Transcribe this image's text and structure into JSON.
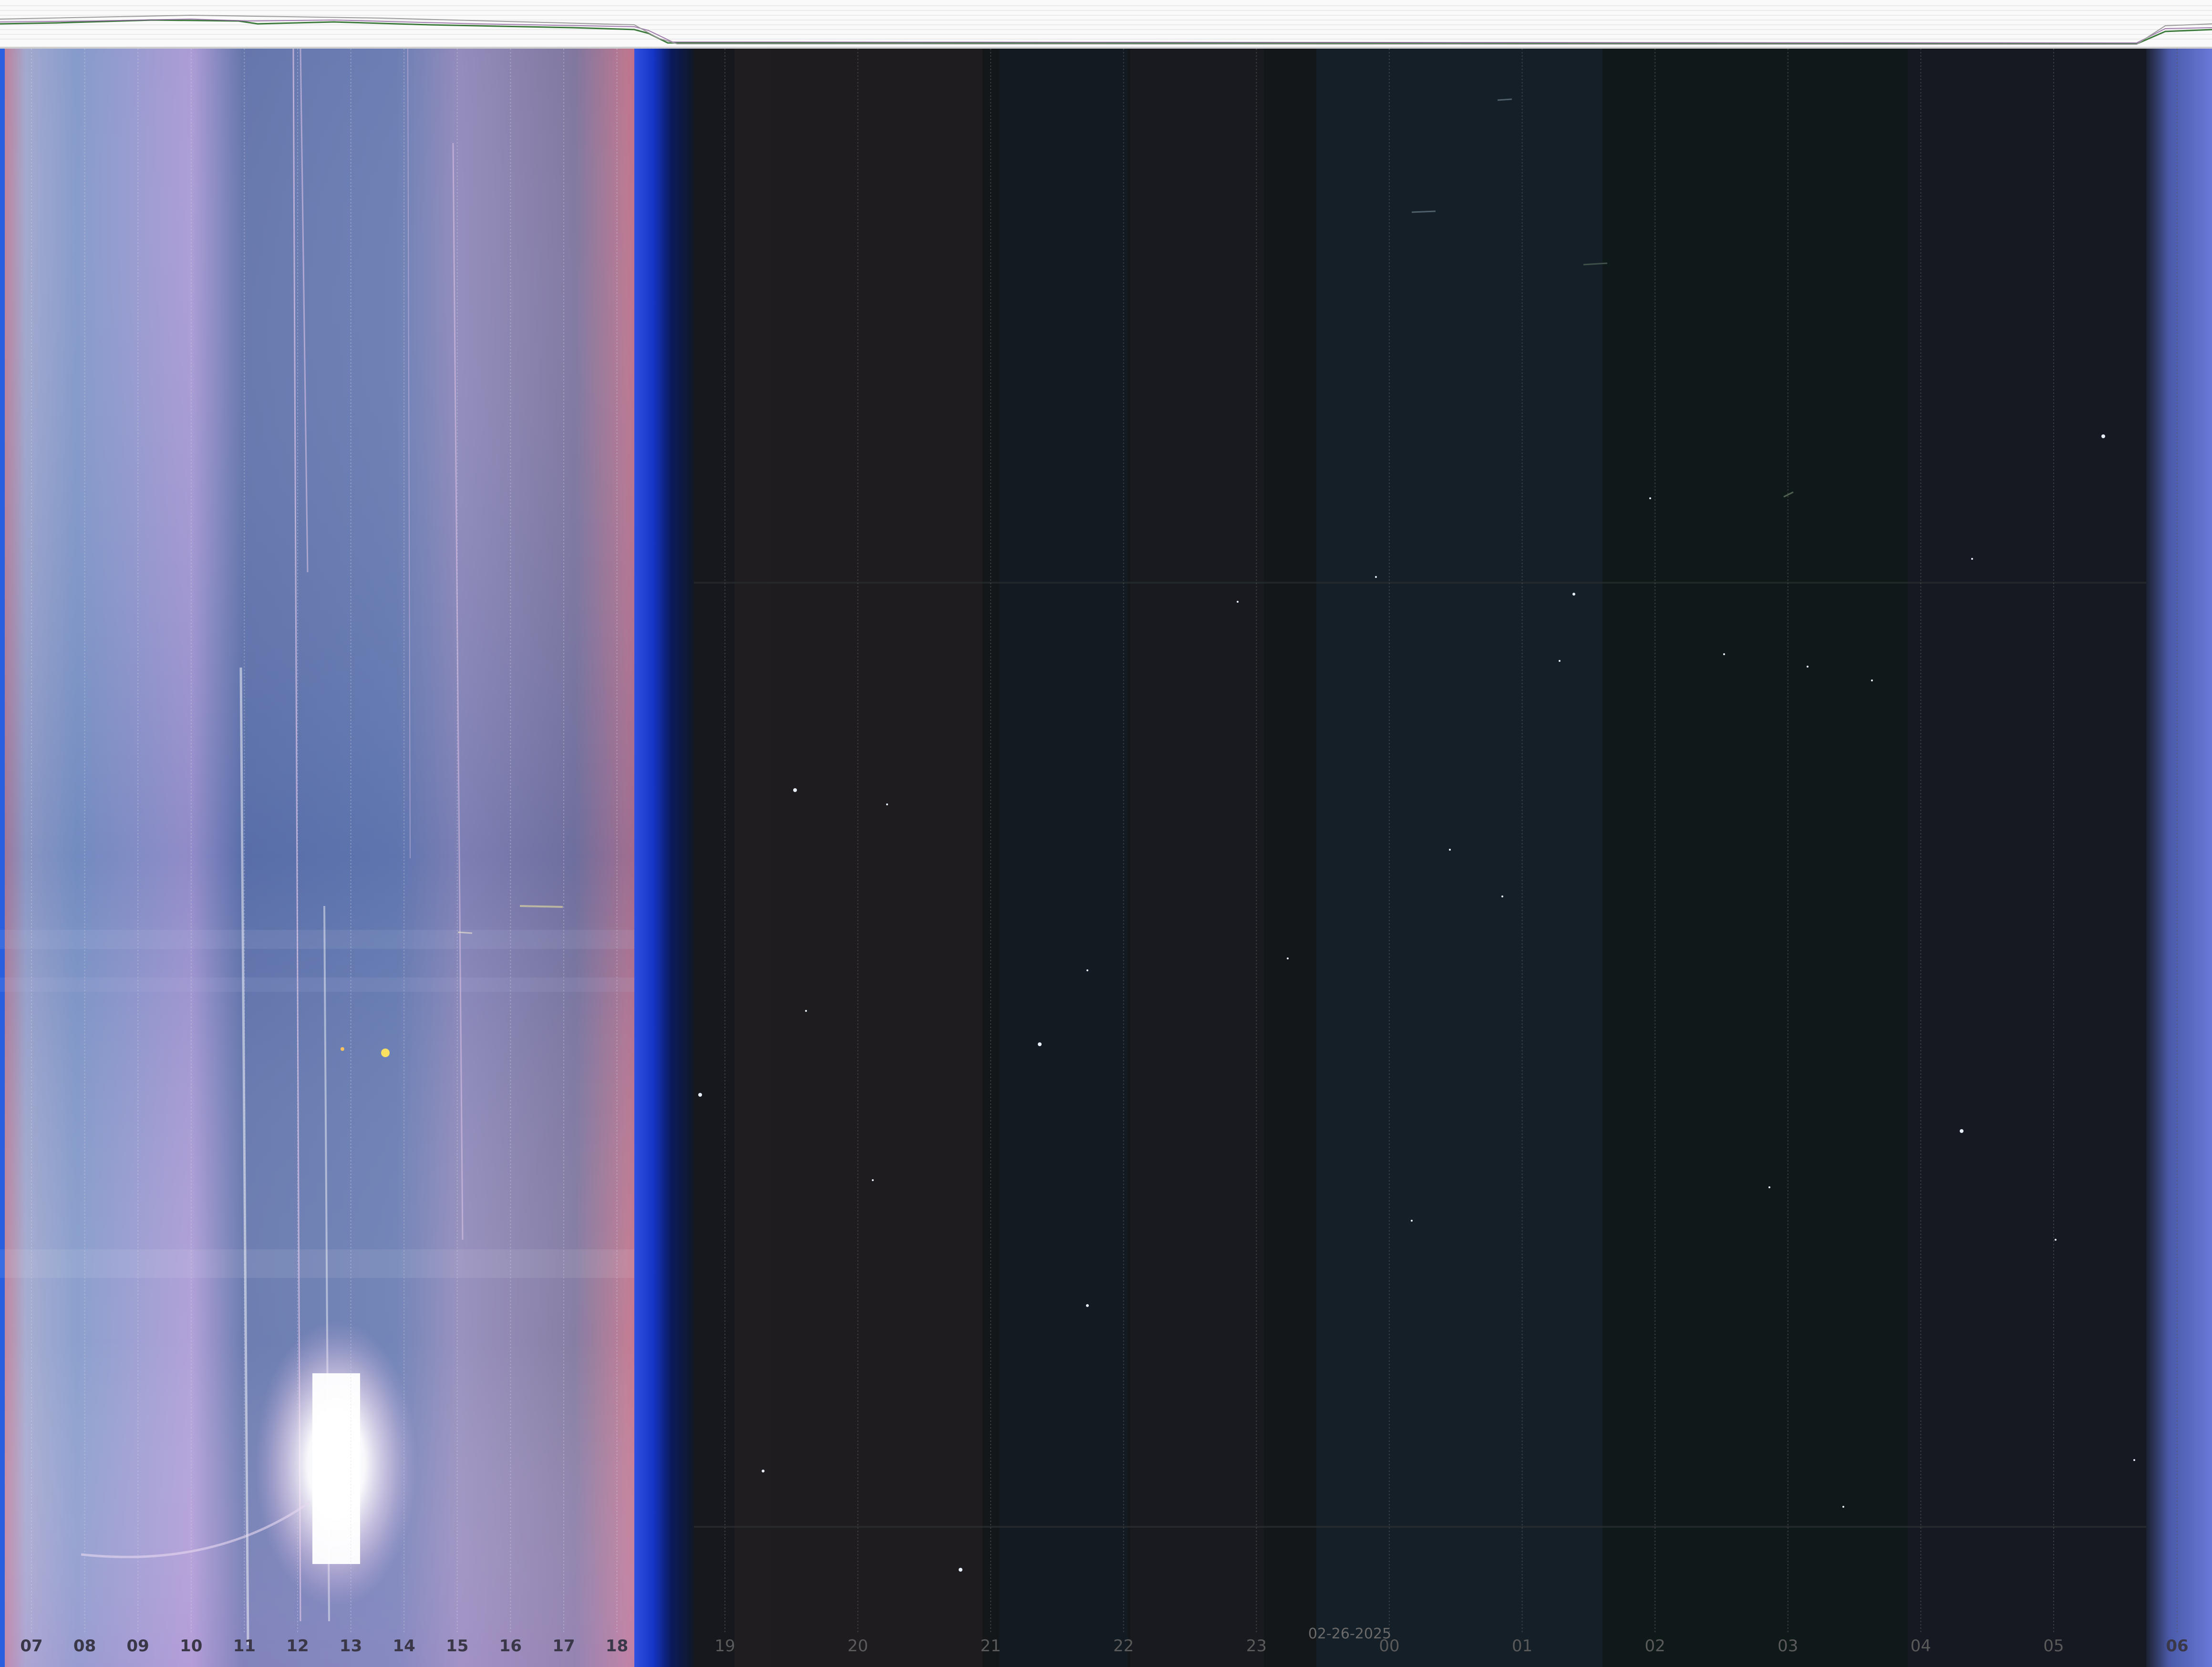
{
  "keogram": {
    "date_label": "02-26-2025",
    "hour_labels": [
      {
        "text": "07",
        "phase": "day"
      },
      {
        "text": "08",
        "phase": "day"
      },
      {
        "text": "09",
        "phase": "day"
      },
      {
        "text": "10",
        "phase": "day"
      },
      {
        "text": "11",
        "phase": "day"
      },
      {
        "text": "12",
        "phase": "day"
      },
      {
        "text": "13",
        "phase": "day"
      },
      {
        "text": "14",
        "phase": "day"
      },
      {
        "text": "15",
        "phase": "day"
      },
      {
        "text": "16",
        "phase": "day"
      },
      {
        "text": "17",
        "phase": "day"
      },
      {
        "text": "18",
        "phase": "day"
      },
      {
        "text": "19",
        "phase": "night"
      },
      {
        "text": "20",
        "phase": "night"
      },
      {
        "text": "21",
        "phase": "night"
      },
      {
        "text": "22",
        "phase": "night"
      },
      {
        "text": "23",
        "phase": "night"
      },
      {
        "text": "00",
        "phase": "night"
      },
      {
        "text": "01",
        "phase": "night"
      },
      {
        "text": "02",
        "phase": "night"
      },
      {
        "text": "03",
        "phase": "night"
      },
      {
        "text": "04",
        "phase": "night"
      },
      {
        "text": "05",
        "phase": "night"
      },
      {
        "text": "06",
        "phase": "day"
      }
    ],
    "colors": {
      "day_sky": "#6f86c2",
      "day_violet": "#a592d0",
      "twilight_blue": "#1a44d8",
      "night_sky": "#141a1c",
      "graph_line_green": "#3b7a3b",
      "graph_line_purple": "#8a5a9a"
    }
  }
}
